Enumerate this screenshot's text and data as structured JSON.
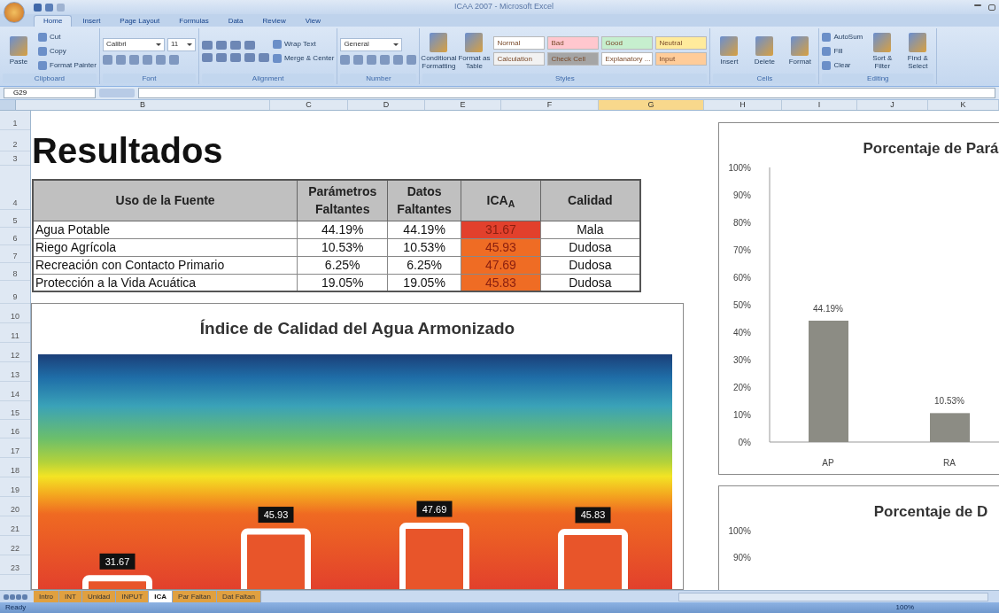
{
  "window": {
    "title": "ICAA 2007 - Microsoft Excel"
  },
  "ribbon_tabs": [
    {
      "label": "Home",
      "selected": true
    },
    {
      "label": "Insert",
      "selected": false
    },
    {
      "label": "Page Layout",
      "selected": false
    },
    {
      "label": "Formulas",
      "selected": false
    },
    {
      "label": "Data",
      "selected": false
    },
    {
      "label": "Review",
      "selected": false
    },
    {
      "label": "View",
      "selected": false
    }
  ],
  "ribbon_groups": [
    {
      "label": "Clipboard",
      "items": [
        {
          "kind": "big",
          "label": "Paste"
        },
        {
          "kind": "small",
          "label": "Cut"
        },
        {
          "kind": "small",
          "label": "Copy"
        },
        {
          "kind": "small",
          "label": "Format Painter"
        }
      ]
    },
    {
      "label": "Font",
      "items": [
        {
          "kind": "field",
          "label": "Calibri"
        },
        {
          "kind": "field",
          "label": "11"
        }
      ]
    },
    {
      "label": "Alignment",
      "items": [
        {
          "kind": "small",
          "label": "Wrap Text"
        },
        {
          "kind": "small",
          "label": "Merge & Center"
        }
      ]
    },
    {
      "label": "Number",
      "items": [
        {
          "kind": "field",
          "label": "General"
        }
      ]
    },
    {
      "label": "Styles",
      "items": [
        {
          "kind": "big",
          "label": "Conditional Formatting"
        },
        {
          "kind": "big",
          "label": "Format as Table"
        }
      ],
      "styles": [
        {
          "kind": "style",
          "label": "Normal",
          "color": "#ffffff"
        },
        {
          "kind": "style",
          "label": "Bad",
          "color": "#ffc7ce"
        },
        {
          "kind": "style",
          "label": "Good",
          "color": "#c6efce"
        },
        {
          "kind": "style",
          "label": "Neutral",
          "color": "#ffeb9c"
        },
        {
          "kind": "style",
          "label": "Calculation",
          "color": "#f2f2f2"
        },
        {
          "kind": "style",
          "label": "Check Cell",
          "color": "#a5a5a5"
        },
        {
          "kind": "style",
          "label": "Explanatory ...",
          "color": "#ffffff"
        },
        {
          "kind": "style",
          "label": "Input",
          "color": "#ffcc99"
        }
      ]
    },
    {
      "label": "Cells",
      "items": [
        {
          "kind": "big",
          "label": "Insert"
        },
        {
          "kind": "big",
          "label": "Delete"
        },
        {
          "kind": "big",
          "label": "Format"
        }
      ]
    },
    {
      "label": "Editing",
      "items": [
        {
          "kind": "small",
          "label": "AutoSum"
        },
        {
          "kind": "small",
          "label": "Fill"
        },
        {
          "kind": "small",
          "label": "Clear"
        },
        {
          "kind": "big",
          "label": "Sort & Filter"
        },
        {
          "kind": "big",
          "label": "Find & Select"
        }
      ]
    }
  ],
  "name_box": "G29",
  "column_headers": [
    {
      "label": "B",
      "selected": false
    },
    {
      "label": "C",
      "selected": false
    },
    {
      "label": "D",
      "selected": false
    },
    {
      "label": "E",
      "selected": false
    },
    {
      "label": "F",
      "selected": false
    },
    {
      "label": "G",
      "selected": true
    },
    {
      "label": "H",
      "selected": false
    },
    {
      "label": "I",
      "selected": false
    },
    {
      "label": "J",
      "selected": false
    },
    {
      "label": "K",
      "selected": false
    }
  ],
  "row_headers": [
    "1",
    "2",
    "3",
    "4",
    "5",
    "6",
    "7",
    "8",
    "9",
    "10",
    "11",
    "12",
    "13",
    "14",
    "15",
    "16",
    "17",
    "18",
    "19",
    "20",
    "21",
    "22",
    "23"
  ],
  "sheet_title": "Resultados",
  "table": {
    "columns": [
      "Uso de la Fuente",
      "Parámetros Faltantes",
      "Datos Faltantes",
      "ICA$_{A}$",
      "Calidad"
    ],
    "rows": [
      {
        "uso": "Agua Potable",
        "parametros": "44.19%",
        "datos": "44.19%",
        "ica": "31.67",
        "color": "#e2402c",
        "calidad": "Mala"
      },
      {
        "uso": "Riego Agrícola",
        "parametros": "10.53%",
        "datos": "10.53%",
        "ica": "45.93",
        "color": "#ef6c24",
        "calidad": "Dudosa"
      },
      {
        "uso": "Recreación con Contacto Primario",
        "parametros": "6.25%",
        "datos": "6.25%",
        "ica": "47.69",
        "color": "#ef6c24",
        "calidad": "Dudosa"
      },
      {
        "uso": "Protección a la Vida Acuática",
        "parametros": "19.05%",
        "datos": "19.05%",
        "ica": "45.83",
        "color": "#ef6c24",
        "calidad": "Dudosa"
      }
    ]
  },
  "charts": [
    {
      "title": "Índice de Calidad del Agua Armonizado",
      "bar_labels": [
        "31.67",
        "45.93",
        "47.69",
        "45.83"
      ]
    },
    {
      "chart_data": {
        "type": "bar",
        "title": "Porcentaje de Pará",
        "categories": [
          "AP",
          "RA"
        ],
        "values": [
          44.19,
          10.53
        ],
        "ylim": [
          0,
          100
        ],
        "yticks": [
          {
            "value": 0,
            "label": "0%"
          },
          {
            "value": 10,
            "label": "10%"
          },
          {
            "value": 20,
            "label": "20%"
          },
          {
            "value": 30,
            "label": "30%"
          },
          {
            "value": 40,
            "label": "40%"
          },
          {
            "value": 50,
            "label": "50%"
          },
          {
            "value": 60,
            "label": "60%"
          },
          {
            "value": 70,
            "label": "70%"
          },
          {
            "value": 80,
            "label": "80%"
          },
          {
            "value": 90,
            "label": "90%"
          },
          {
            "value": 100,
            "label": "100%"
          }
        ],
        "value_labels": [
          "44.19%",
          "10.53%"
        ]
      }
    },
    {
      "title": "Porcentaje de D",
      "axis_labels": [
        "100%",
        "90%"
      ]
    }
  ],
  "sheet_tabs": [
    {
      "label": "Intro",
      "selected": false
    },
    {
      "label": "INT",
      "selected": false
    },
    {
      "label": "Unidad",
      "selected": false
    },
    {
      "label": "INPUT",
      "selected": false
    },
    {
      "label": "ICA",
      "selected": true
    },
    {
      "label": "Par Faltan",
      "selected": false
    },
    {
      "label": "Dat Faltan",
      "selected": false
    }
  ],
  "status": {
    "text": "Ready",
    "zoom": "100%"
  }
}
